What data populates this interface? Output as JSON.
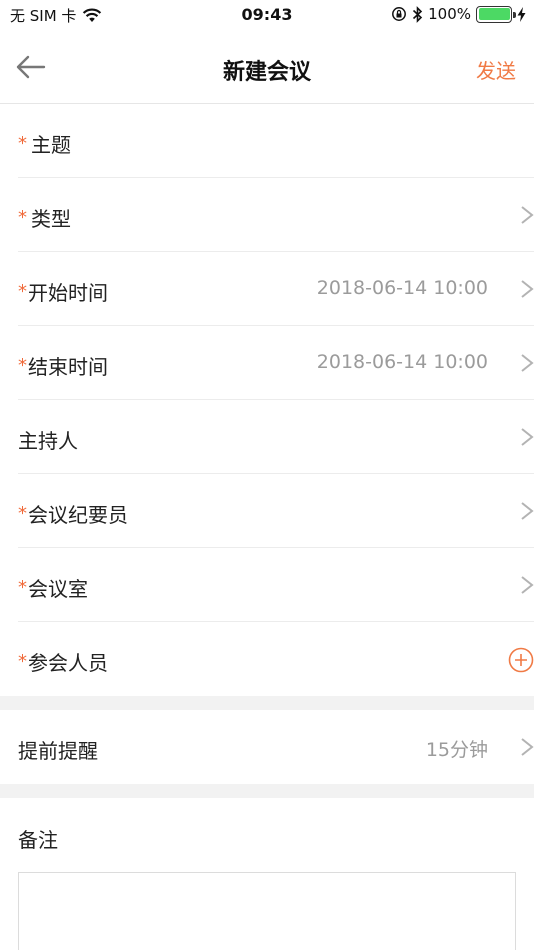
{
  "status_bar": {
    "carrier": "无 SIM 卡",
    "time": "09:43",
    "battery_percent": "100%",
    "battery_level": 1.0,
    "icons": [
      "wifi-icon",
      "orientation-lock-icon",
      "bluetooth-icon",
      "battery-icon",
      "charging-icon"
    ]
  },
  "nav": {
    "title": "新建会议",
    "send_label": "发送",
    "back_icon": "back-arrow-icon"
  },
  "form": {
    "rows": [
      {
        "label": "主题",
        "required": true,
        "value": ""
      },
      {
        "label": "类型",
        "required": true,
        "value": ""
      },
      {
        "label": "开始时间",
        "required": true,
        "value": "2018-06-14 10:00"
      },
      {
        "label": "结束时间",
        "required": true,
        "value": "2018-06-14 10:00"
      },
      {
        "label": "主持人",
        "required": false,
        "value": ""
      },
      {
        "label": "会议纪要员",
        "required": true,
        "value": ""
      },
      {
        "label": "会议室",
        "required": true,
        "value": ""
      },
      {
        "label": "参会人员",
        "required": true,
        "value": ""
      }
    ],
    "required_mark": "*"
  },
  "reminder": {
    "label": "提前提醒",
    "value": "15分钟"
  },
  "remark": {
    "label": "备注",
    "value": ""
  },
  "colors": {
    "accent": "#f07a45",
    "required": "#f06a3a",
    "value_text": "#9b9b9b",
    "section_gap": "#f2f2f2"
  }
}
